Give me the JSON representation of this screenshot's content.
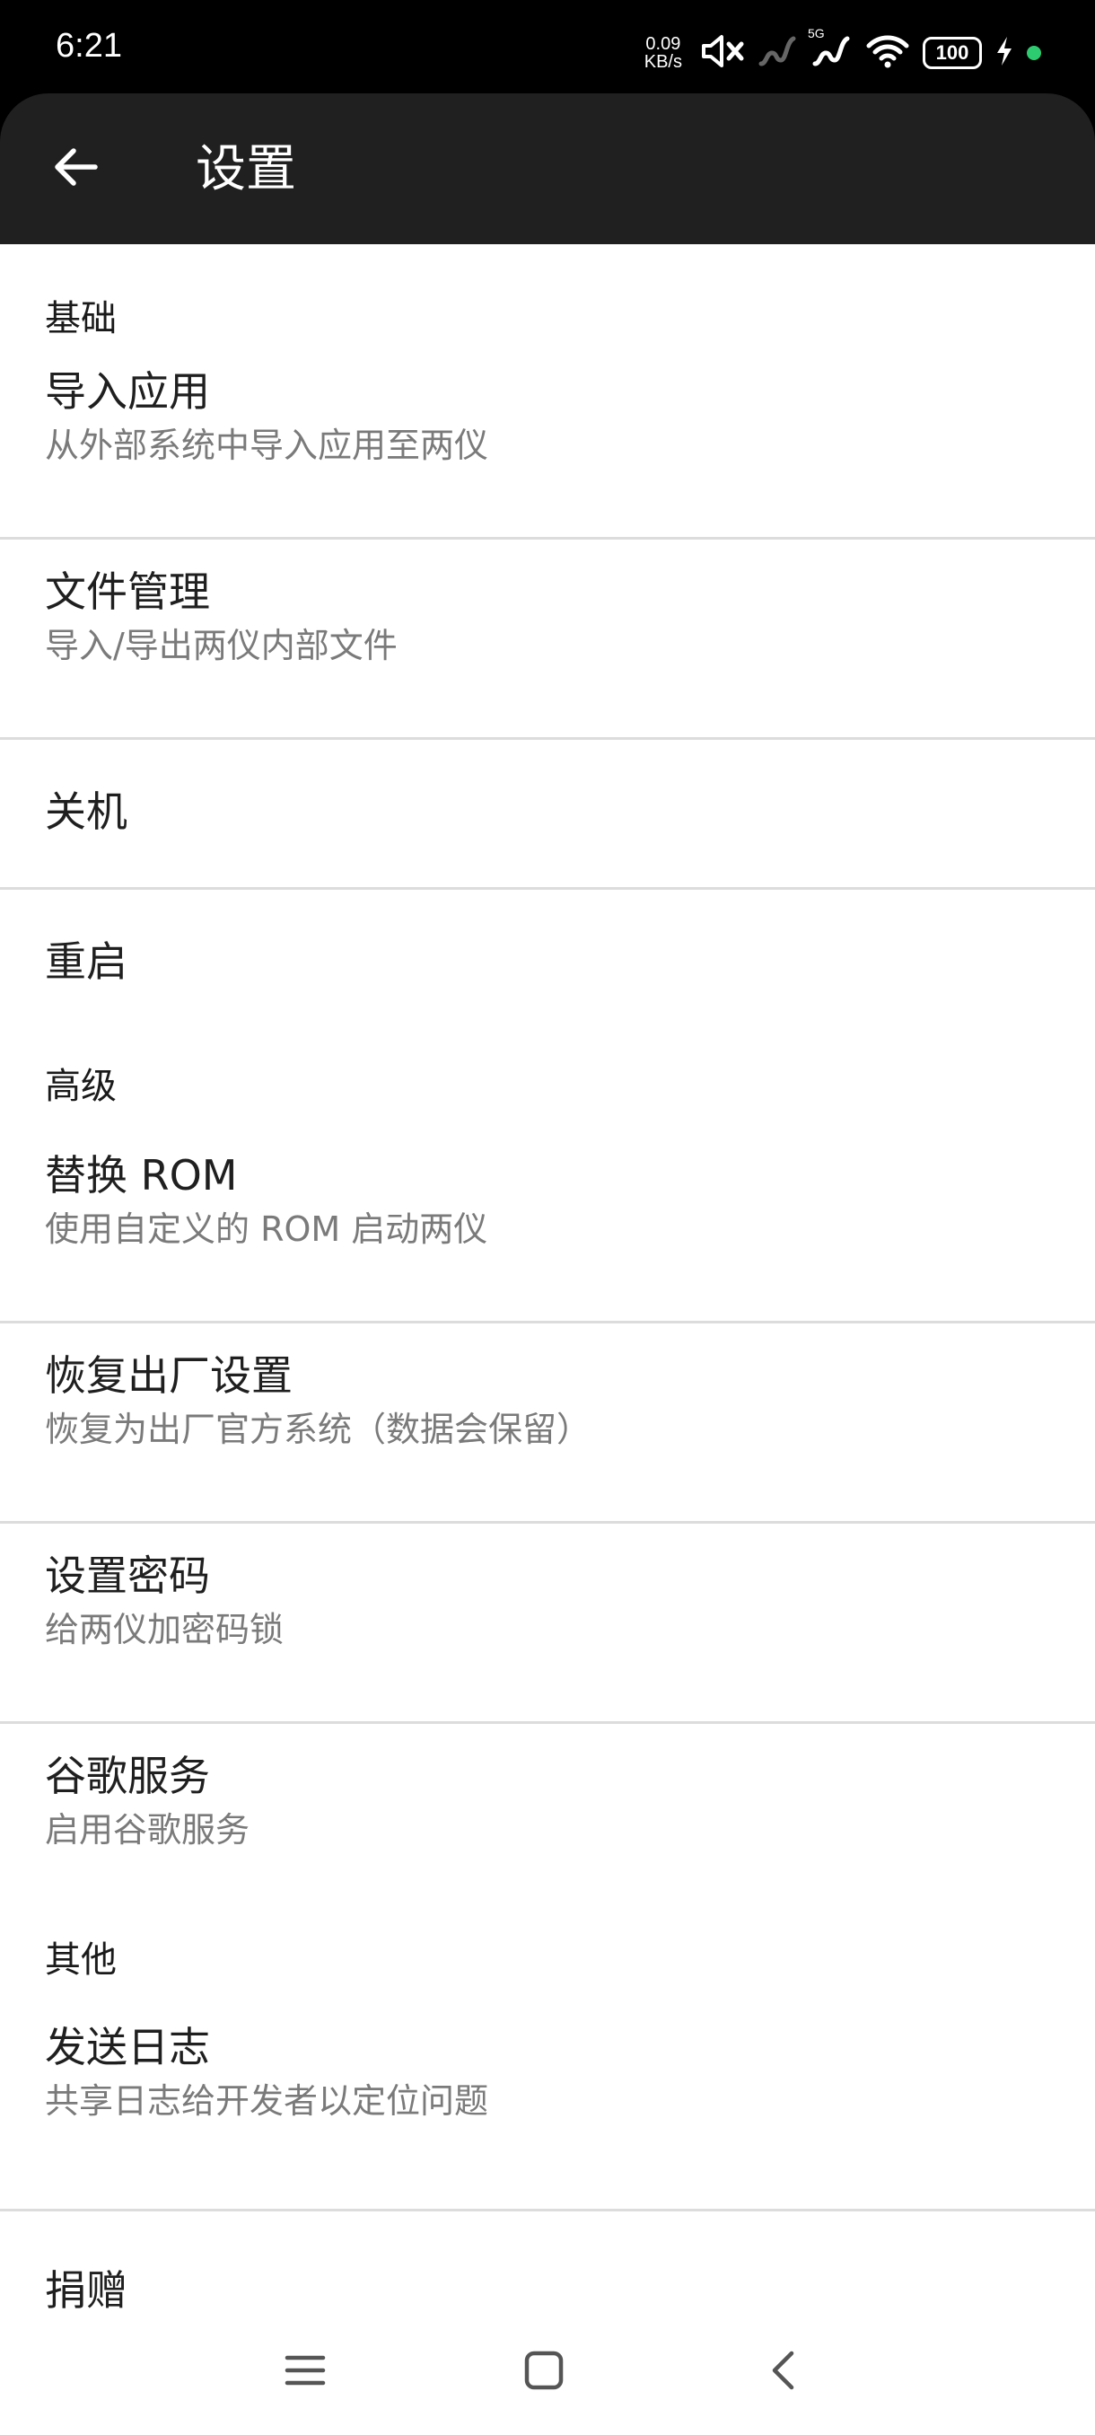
{
  "status_bar": {
    "time": "6:21",
    "net_speed_value": "0.09",
    "net_speed_unit": "KB/s",
    "network_type": "5G",
    "battery": "100"
  },
  "app_bar": {
    "title": "设置"
  },
  "sections": [
    {
      "header": "基础",
      "items": [
        {
          "title": "导入应用",
          "subtitle": "从外部系统中导入应用至两仪"
        },
        {
          "title": "文件管理",
          "subtitle": "导入/导出两仪内部文件"
        },
        {
          "title": "关机"
        },
        {
          "title": "重启"
        }
      ]
    },
    {
      "header": "高级",
      "items": [
        {
          "title": "替换 ROM",
          "subtitle": "使用自定义的 ROM 启动两仪"
        },
        {
          "title": "恢复出厂设置",
          "subtitle": "恢复为出厂官方系统（数据会保留）"
        },
        {
          "title": "设置密码",
          "subtitle": "给两仪加密码锁"
        },
        {
          "title": "谷歌服务",
          "subtitle": "启用谷歌服务"
        }
      ]
    },
    {
      "header": "其他",
      "items": [
        {
          "title": "发送日志",
          "subtitle": "共享日志给开发者以定位问题"
        },
        {
          "title": "捐赠"
        }
      ]
    }
  ],
  "colors": {
    "app_bar": "#202020",
    "status_bar": "#000000",
    "divider": "#dcdcdc",
    "charging_dot": "#2ecc71"
  },
  "icons": {
    "back": "arrow-left-icon",
    "mute": "volume-mute-icon",
    "signal": "cellular-signal-icon",
    "wifi": "wifi-icon",
    "battery": "battery-icon",
    "charging": "lightning-icon",
    "nav_menu": "menu-icon",
    "nav_home": "square-icon",
    "nav_back": "chevron-left-icon"
  }
}
